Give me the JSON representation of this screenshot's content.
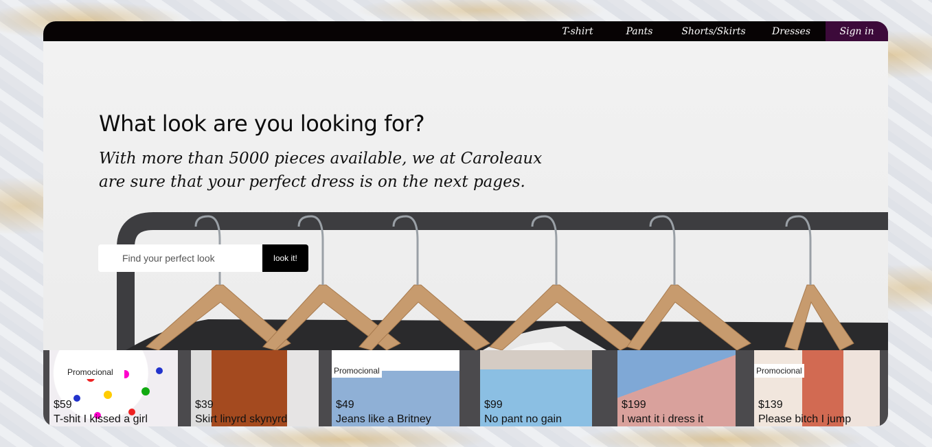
{
  "nav": {
    "items": [
      "T-shirt",
      "Pants",
      "Shorts/Skirts",
      "Dresses"
    ],
    "signin": "Sign in"
  },
  "hero": {
    "headline": "What look are you looking for?",
    "tagline": "With more than 5000 pieces available, we at Caroleaux are sure that your perfect dress is on the next pages."
  },
  "search": {
    "placeholder": "Find your perfect look",
    "button": "look it!"
  },
  "products": [
    {
      "price": "$59",
      "name": "T-shit I kissed a girl",
      "badge": "Promocional"
    },
    {
      "price": "$39",
      "name": "Skirt linyrd skynyrd",
      "badge": ""
    },
    {
      "price": "$49",
      "name": "Jeans like a Britney",
      "badge": "Promocional"
    },
    {
      "price": "$99",
      "name": "No pant no gain",
      "badge": ""
    },
    {
      "price": "$199",
      "name": "I want it i dress it",
      "badge": ""
    },
    {
      "price": "$139",
      "name": "Please bitch I jump",
      "badge": "Promocional"
    }
  ],
  "colors": {
    "nav_bg": "#070304",
    "signin_bg": "#3c0a3a",
    "products_bg": "#4b4a4d"
  }
}
